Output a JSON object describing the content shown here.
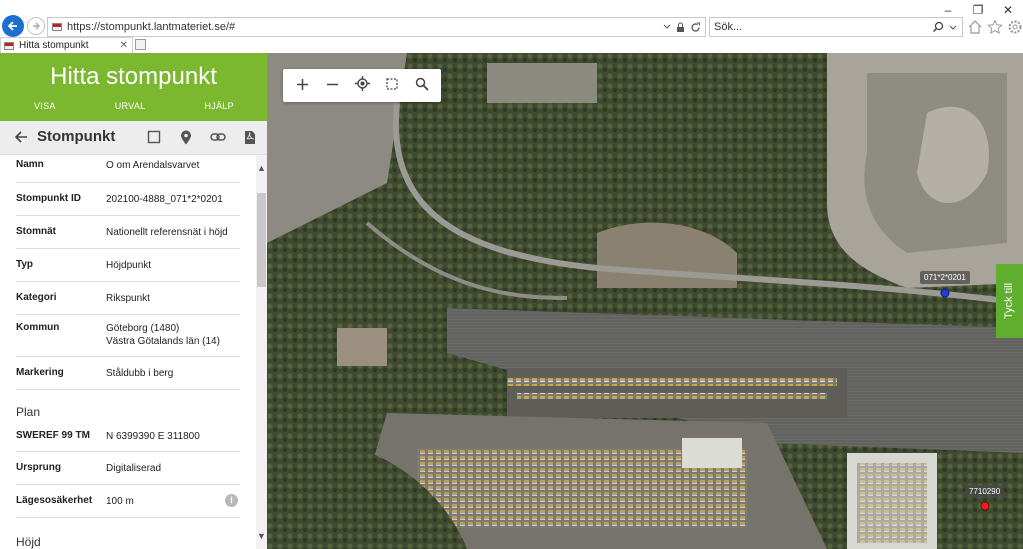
{
  "browser": {
    "url": "https://stompunkt.lantmateriet.se/#",
    "search_placeholder": "Sök...",
    "tab_title": "Hitta stompunkt"
  },
  "panel": {
    "app_title": "Hitta stompunkt",
    "menu": [
      "VISA",
      "URVAL",
      "HJÄLP"
    ],
    "toolbar_title": "Stompunkt",
    "fields": [
      {
        "label": "Namn",
        "value": "O om Arendalsvarvet"
      },
      {
        "label": "Stompunkt ID",
        "value": "202100-4888_071*2*0201"
      },
      {
        "label": "Stomnät",
        "value": "Nationellt referensnät i höjd"
      },
      {
        "label": "Typ",
        "value": "Höjdpunkt"
      },
      {
        "label": "Kategori",
        "value": "Rikspunkt"
      },
      {
        "label": "Kommun",
        "value": "Göteborg (1480)",
        "value2": "Västra Götalands län (14)"
      },
      {
        "label": "Markering",
        "value": "Ståldubb i berg"
      }
    ],
    "plan_heading": "Plan",
    "plan_fields": [
      {
        "label": "SWEREF 99 TM",
        "value": "N 6399390 E 311800"
      },
      {
        "label": "Ursprung",
        "value": "Digitaliserad"
      },
      {
        "label": "Lägesosäkerhet",
        "value": "100 m"
      }
    ],
    "height_heading": "Höjd",
    "info_glyph": "i"
  },
  "map": {
    "markers": [
      {
        "label": "071*2*0201",
        "color": "#1f3fd6"
      },
      {
        "label": "7710290",
        "color": "#e02020"
      }
    ],
    "feedback_label": "Tyck till"
  },
  "colors": {
    "brand_green": "#7cb82f",
    "feedback_green": "#5fae2e",
    "browser_blue": "#1a6fd1"
  },
  "icons": [
    "back-arrow-icon",
    "forward-arrow-icon",
    "search-icon",
    "lock-icon",
    "refresh-icon",
    "home-icon",
    "star-icon",
    "gear-icon",
    "square-icon",
    "location-pin-icon",
    "link-icon",
    "pdf-icon",
    "zoom-in-icon",
    "zoom-out-icon",
    "locate-icon",
    "select-area-icon",
    "magnify-icon",
    "info-icon"
  ]
}
